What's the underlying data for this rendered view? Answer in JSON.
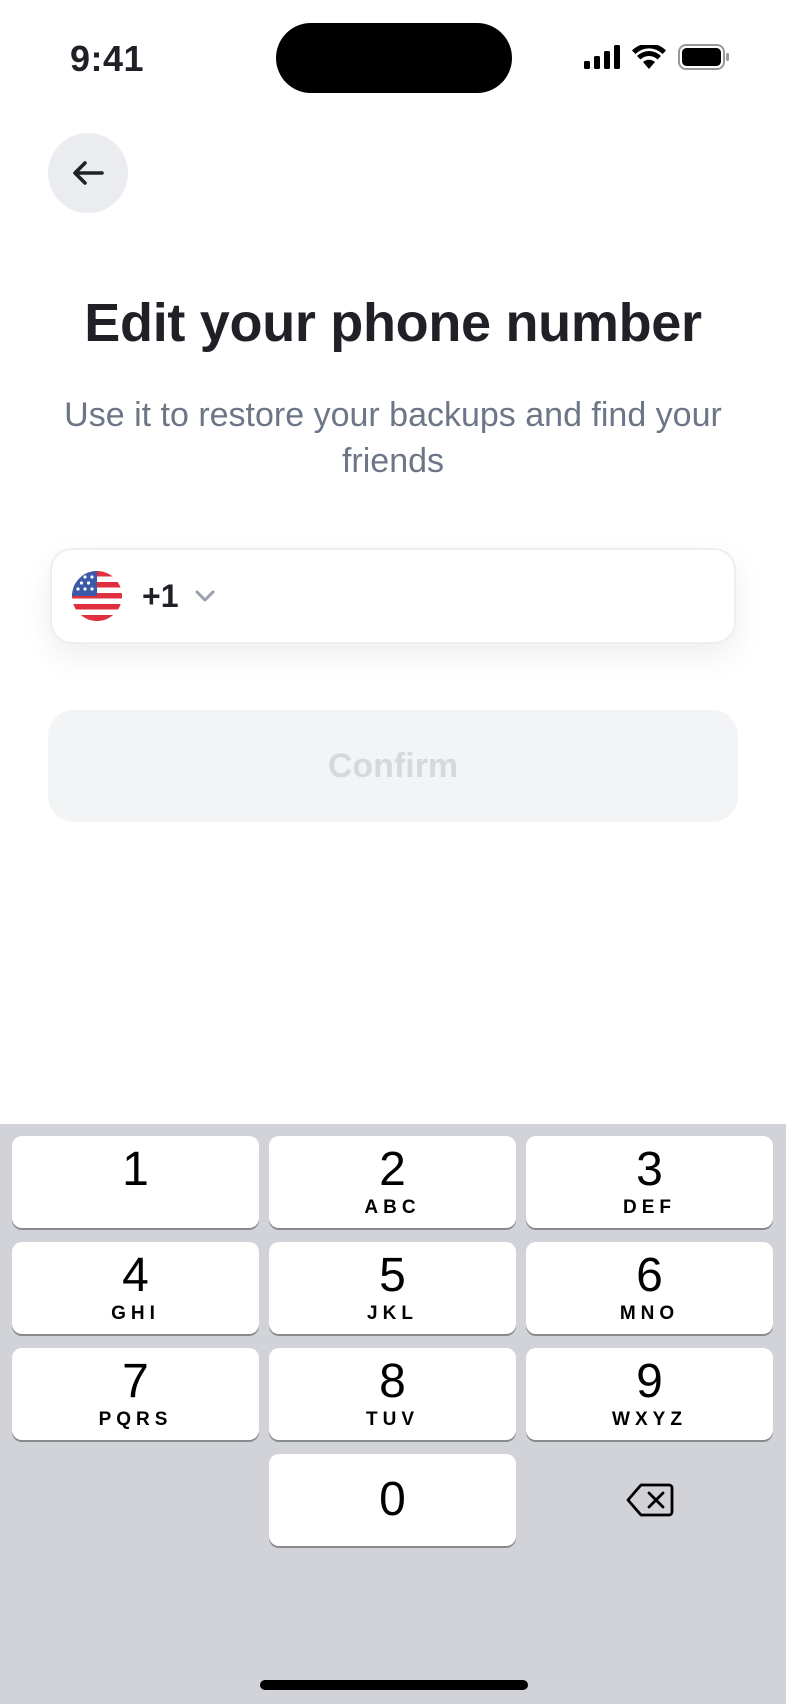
{
  "status_bar": {
    "time": "9:41",
    "icons": [
      "signal-icon",
      "wifi-icon",
      "battery-icon"
    ]
  },
  "header": {
    "back_icon": "arrow-left-icon"
  },
  "main": {
    "title": "Edit your phone number",
    "subtitle": "Use it to restore your backups and find your friends",
    "phone_field": {
      "country_flag": "us-flag-icon",
      "dial_code": "+1",
      "dropdown_icon": "chevron-down-icon",
      "value": ""
    },
    "confirm_label": "Confirm"
  },
  "keyboard": {
    "keys": [
      {
        "num": "1",
        "letters": ""
      },
      {
        "num": "2",
        "letters": "ABC"
      },
      {
        "num": "3",
        "letters": "DEF"
      },
      {
        "num": "4",
        "letters": "GHI"
      },
      {
        "num": "5",
        "letters": "JKL"
      },
      {
        "num": "6",
        "letters": "MNO"
      },
      {
        "num": "7",
        "letters": "PQRS"
      },
      {
        "num": "8",
        "letters": "TUV"
      },
      {
        "num": "9",
        "letters": "WXYZ"
      },
      {
        "num": "0",
        "letters": ""
      }
    ],
    "delete_icon": "backspace-icon"
  },
  "colors": {
    "title": "#1f2126",
    "subtitle": "#6c7686",
    "confirm_bg": "#f3f4f6",
    "confirm_text": "#d5d8dd",
    "keyboard_bg": "#d1d3d9"
  }
}
